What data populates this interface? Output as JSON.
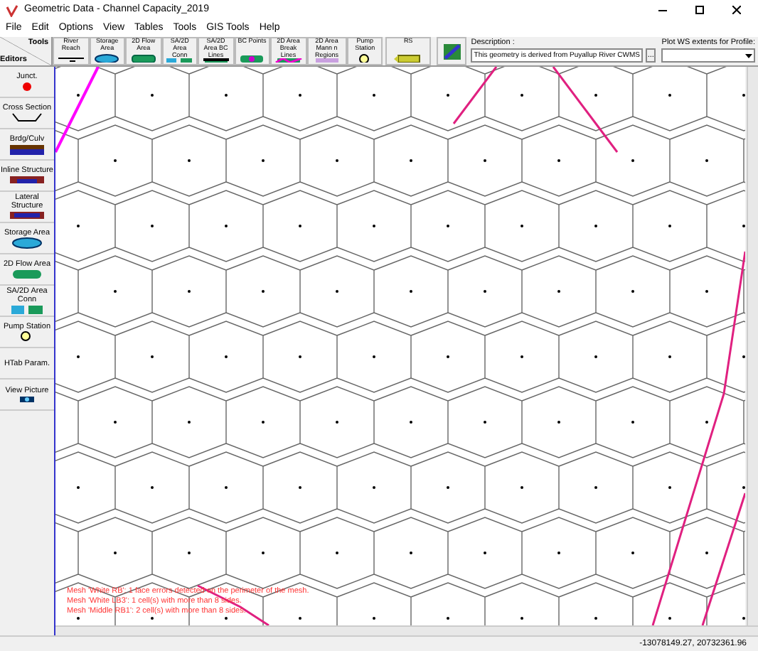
{
  "window": {
    "title": "Geometric Data - Channel Capacity_2019"
  },
  "menu": [
    "File",
    "Edit",
    "Options",
    "View",
    "Tables",
    "Tools",
    "GIS Tools",
    "Help"
  ],
  "corner": {
    "tools": "Tools",
    "editors": "Editors"
  },
  "tools": [
    "River Reach",
    "Storage Area",
    "2D Flow Area",
    "SA/2D Area Conn",
    "SA/2D Area BC Lines",
    "BC Points",
    "2D Area Break Lines",
    "2D Area Mann n Regions",
    "Pump Station",
    "RS"
  ],
  "description": {
    "label": "Description :",
    "value": "This geometry is derived from Puyallup River CWMS",
    "browse": "..."
  },
  "plot_ws": {
    "label": "Plot WS extents for Profile:"
  },
  "editors": [
    "Junct.",
    "Cross Section",
    "Brdg/Culv",
    "Inline Structure",
    "Lateral Structure",
    "Storage Area",
    "2D Flow Area",
    "SA/2D Area Conn",
    "Pump Station",
    "HTab Param.",
    "View Picture"
  ],
  "messages": [
    "Mesh 'White RB': 1 face errors detected on the perimeter of the mesh.",
    "Mesh 'White LB3': 1 cell(s) with more than 8 sides.",
    "Mesh 'Middle RB1': 2 cell(s) with more than 8 sides."
  ],
  "status_bar": {
    "coordinates": "-13078149.27, 20732361.96"
  }
}
